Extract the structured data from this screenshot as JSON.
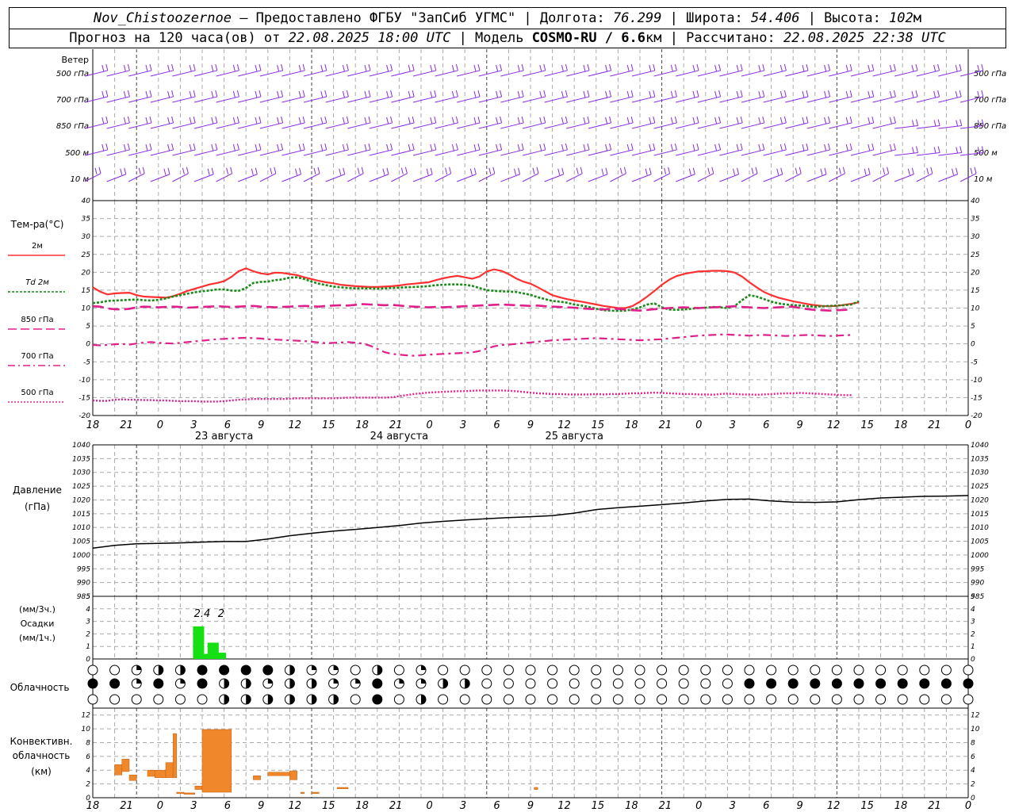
{
  "header": {
    "station": "Nov_Chistoozernoe",
    "provider": " – Предоставлено ФГБУ \"ЗапСиб УГМС\" | Долгота: ",
    "lon": "76.299",
    "lat_label": " | Широта: ",
    "lat": "54.406",
    "alt_label": " | Высота: ",
    "alt": "102",
    "alt_unit": "м",
    "forecast_label": "Прогноз на 120 часа(ов) от ",
    "forecast_from": "22.08.2025 18:00 UTC",
    "model_label": "  | Модель ",
    "model": "COSMO-RU / 6.6",
    "model_unit": "км",
    "computed_label": " | Рассчитано: ",
    "computed": "22.08.2025 22:38 UTC"
  },
  "labels": {
    "wind": "Ветер",
    "levels": [
      "500 гПа",
      "700 гПа",
      "850 гПа",
      "500 м",
      "10 м"
    ],
    "temp": "Тем-ра(°C)",
    "legend": [
      {
        "name": "2м",
        "color": "#ff3030",
        "dash": ""
      },
      {
        "name": "Td 2м",
        "color": "#178a17",
        "dash": "3,2"
      },
      {
        "name": "850 гПа",
        "color": "#e0208a",
        "dash": "11,5"
      },
      {
        "name": "700 гПа",
        "color": "#e0208a",
        "dash": "9,4,2,4"
      },
      {
        "name": "500 гПа",
        "color": "#e0208a",
        "dash": "2,2"
      }
    ],
    "pressure": "Давление",
    "pressure_unit": "(гПа)",
    "precip": [
      "(мм/3ч.)",
      "Осадки",
      "(мм/1ч.)"
    ],
    "precip_values": [
      "2.4",
      "2"
    ],
    "cloud": "Облачность",
    "conv": [
      "Конвективн.",
      "облачность",
      "(км)"
    ],
    "dates": [
      "23 августа",
      "24 августа",
      "25 августа"
    ],
    "hours": [
      "18",
      "21",
      "0",
      "3",
      "6",
      "9",
      "12",
      "15",
      "18",
      "21",
      "0",
      "3",
      "6",
      "9",
      "12",
      "15",
      "18",
      "21",
      "0",
      "3",
      "6",
      "9",
      "12",
      "15",
      "18",
      "21",
      "0"
    ]
  },
  "chart_data": [
    {
      "type": "line",
      "title": "Тем-ра(°C)",
      "ylim": [
        -20,
        40
      ],
      "x_hours_from_start": [
        0,
        1,
        2,
        3,
        4,
        5,
        6,
        7,
        8,
        9,
        10,
        11,
        12,
        13,
        14,
        15,
        16,
        17,
        18,
        19,
        20,
        21,
        22,
        23,
        24,
        25,
        26,
        27,
        28,
        29,
        30,
        31,
        32,
        33,
        34,
        35,
        36,
        37,
        38,
        39,
        40,
        41,
        42,
        43,
        44,
        45,
        46,
        47,
        48,
        49,
        50,
        51,
        52,
        53,
        54,
        55,
        56,
        57,
        58,
        59,
        60,
        61,
        62,
        63,
        64,
        65,
        66,
        67,
        68,
        69,
        70,
        71,
        72,
        73,
        74,
        75,
        76,
        77,
        78,
        79,
        80,
        81,
        82,
        83,
        84,
        85,
        86,
        87,
        88,
        89,
        90,
        91,
        92,
        93,
        94,
        95,
        96,
        97,
        98,
        99,
        100,
        101,
        102,
        103,
        104,
        105,
        106,
        107,
        108,
        109,
        110,
        111,
        112,
        113,
        114,
        115,
        116,
        117,
        118,
        119,
        120
      ],
      "series": [
        {
          "name": "2м",
          "values": [
            15.8,
            14.6,
            13.8,
            14.1,
            14.2,
            14.3,
            13.6,
            13.2,
            13.1,
            13.0,
            12.9,
            13.3,
            14.0,
            14.8,
            15.4,
            16.0,
            16.6,
            17.0,
            17.5,
            18.7,
            20.3,
            21.1,
            20.3,
            19.7,
            19.4,
            19.9,
            19.8,
            19.5,
            19.2,
            18.6,
            18.1,
            17.6,
            17.2,
            16.9,
            16.5,
            16.3,
            16.1,
            16.0,
            15.9,
            15.9,
            16.0,
            16.1,
            16.3,
            16.6,
            16.8,
            17.0,
            17.2,
            17.8,
            18.3,
            18.7,
            19.0,
            18.6,
            18.2,
            18.8,
            20.2,
            20.8,
            20.4,
            19.5,
            18.3,
            17.4,
            16.8,
            15.8,
            14.7,
            13.6,
            13.0,
            12.5,
            12.1,
            11.8,
            11.4,
            11.0,
            10.6,
            10.3,
            10.0,
            10.0,
            10.6,
            11.8,
            13.2,
            14.8,
            16.5,
            17.9,
            18.9,
            19.5,
            19.9,
            20.2,
            20.3,
            20.4,
            20.4,
            20.3,
            19.9,
            18.8,
            17.2,
            15.8,
            14.5,
            13.6,
            12.9,
            12.4,
            11.9,
            11.5,
            11.1,
            10.8,
            10.6,
            10.5,
            10.6,
            10.9,
            11.2,
            11.6
          ]
        },
        {
          "name": "Td 2м",
          "values": [
            11.4,
            11.6,
            12.0,
            12.1,
            12.2,
            12.3,
            12.4,
            12.2,
            12.1,
            12.3,
            12.7,
            13.2,
            13.6,
            14.0,
            14.4,
            14.7,
            14.9,
            15.2,
            15.2,
            14.9,
            14.8,
            15.6,
            17.0,
            17.3,
            17.4,
            17.8,
            18.0,
            18.5,
            18.6,
            18.1,
            17.4,
            16.8,
            16.4,
            16.0,
            15.8,
            15.6,
            15.5,
            15.5,
            15.5,
            15.4,
            15.5,
            15.6,
            15.7,
            15.8,
            15.9,
            16.0,
            16.1,
            16.4,
            16.5,
            16.6,
            16.6,
            16.5,
            16.2,
            15.6,
            15.0,
            14.8,
            14.7,
            14.6,
            14.5,
            14.1,
            13.7,
            13.0,
            12.5,
            12.0,
            11.8,
            11.5,
            11.0,
            10.7,
            10.3,
            9.8,
            9.4,
            9.3,
            9.2,
            9.3,
            9.6,
            10.2,
            11.0,
            11.3,
            10.2,
            9.6,
            9.5,
            9.6,
            9.8,
            10.0,
            10.1,
            10.3,
            10.2,
            10.0,
            10.6,
            12.2,
            13.6,
            13.2,
            12.5,
            11.8,
            11.3,
            11.0,
            10.8,
            10.7,
            10.5,
            10.4,
            10.5,
            10.6,
            10.7,
            10.8,
            11.0,
            11.9
          ]
        },
        {
          "name": "850 гПа",
          "values": [
            10.5,
            10.4,
            9.9,
            9.7,
            9.6,
            9.8,
            10.2,
            10.4,
            10.3,
            10.2,
            10.3,
            10.4,
            10.3,
            10.1,
            10.2,
            10.3,
            10.4,
            10.5,
            10.4,
            10.3,
            10.4,
            10.5,
            10.6,
            10.4,
            10.3,
            10.2,
            10.3,
            10.4,
            10.5,
            10.6,
            10.5,
            10.4,
            10.6,
            10.7,
            10.8,
            10.7,
            10.9,
            11.1,
            11.0,
            10.9,
            10.8,
            10.9,
            10.7,
            10.5,
            10.4,
            10.3,
            10.2,
            10.3,
            10.2,
            10.3,
            10.4,
            10.5,
            10.6,
            10.7,
            10.8,
            10.9,
            11.0,
            10.9,
            10.8,
            10.7,
            10.6,
            10.7,
            10.5,
            10.4,
            10.3,
            10.2,
            10.1,
            9.9,
            9.8,
            9.7,
            9.6,
            9.7,
            9.8,
            9.6,
            9.4,
            9.3,
            9.5,
            9.7,
            9.9,
            10.0,
            10.1,
            10.2,
            10.1,
            10.0,
            10.1,
            10.2,
            10.3,
            10.4,
            10.5,
            10.3,
            10.2,
            10.1,
            10.0,
            10.1,
            10.2,
            10.3,
            10.4,
            10.0,
            9.7,
            9.5,
            9.4,
            9.3,
            9.4,
            9.5,
            9.6
          ]
        },
        {
          "name": "700 гПа",
          "values": [
            -0.3,
            -0.4,
            -0.3,
            -0.1,
            0.0,
            -0.2,
            0.1,
            0.4,
            0.5,
            0.3,
            0.2,
            0.1,
            0.3,
            0.5,
            0.7,
            0.9,
            1.1,
            1.3,
            1.4,
            1.5,
            1.6,
            1.7,
            1.6,
            1.5,
            1.3,
            1.2,
            1.1,
            1.0,
            0.9,
            0.8,
            0.6,
            0.4,
            0.2,
            0.3,
            0.4,
            0.5,
            0.3,
            0.1,
            -0.5,
            -1.4,
            -2.3,
            -2.8,
            -3.0,
            -3.2,
            -3.3,
            -3.2,
            -3.0,
            -2.9,
            -2.8,
            -2.7,
            -2.6,
            -2.5,
            -2.4,
            -2.0,
            -1.3,
            -0.7,
            -0.3,
            -0.2,
            0.0,
            0.2,
            0.4,
            0.6,
            0.8,
            1.0,
            1.1,
            1.2,
            1.3,
            1.4,
            1.5,
            1.6,
            1.5,
            1.4,
            1.3,
            1.2,
            1.1,
            1.0,
            1.1,
            1.2,
            1.3,
            1.5,
            1.7,
            1.9,
            2.1,
            2.3,
            2.4,
            2.5,
            2.6,
            2.6,
            2.5,
            2.4,
            2.3,
            2.4,
            2.5,
            2.4,
            2.3,
            2.2,
            2.3,
            2.4,
            2.5,
            2.4,
            2.3,
            2.2,
            2.3,
            2.4,
            2.5
          ]
        },
        {
          "name": "500 гПа",
          "values": [
            -15.8,
            -15.9,
            -15.9,
            -15.6,
            -15.5,
            -15.6,
            -15.6,
            -15.7,
            -15.7,
            -15.8,
            -15.8,
            -15.9,
            -16.0,
            -16.0,
            -16.0,
            -16.1,
            -16.1,
            -16.1,
            -16.0,
            -15.8,
            -15.6,
            -15.5,
            -15.4,
            -15.4,
            -15.4,
            -15.4,
            -15.4,
            -15.3,
            -15.2,
            -15.2,
            -15.2,
            -15.2,
            -15.2,
            -15.2,
            -15.1,
            -15.0,
            -15.0,
            -15.0,
            -15.0,
            -15.0,
            -15.0,
            -14.9,
            -14.6,
            -14.3,
            -14.0,
            -13.8,
            -13.6,
            -13.5,
            -13.4,
            -13.3,
            -13.2,
            -13.2,
            -13.1,
            -13.0,
            -13.0,
            -13.0,
            -13.0,
            -13.1,
            -13.2,
            -13.4,
            -13.6,
            -13.8,
            -13.9,
            -14.0,
            -14.0,
            -14.1,
            -14.1,
            -14.1,
            -14.1,
            -14.0,
            -14.1,
            -14.0,
            -14.0,
            -13.9,
            -13.8,
            -13.8,
            -13.7,
            -13.6,
            -13.7,
            -13.8,
            -13.9,
            -14.0,
            -14.0,
            -14.1,
            -14.1,
            -14.2,
            -14.0,
            -13.9,
            -14.0,
            -14.1,
            -14.1,
            -14.2,
            -14.1,
            -14.0,
            -13.9,
            -13.8,
            -13.8,
            -13.7,
            -13.8,
            -13.9,
            -14.0,
            -14.1,
            -14.2,
            -14.3,
            -14.3
          ]
        }
      ]
    },
    {
      "type": "line",
      "title": "Давление",
      "ylabel": "(гПа)",
      "ylim": [
        985,
        1040
      ],
      "x_hours_from_start": [
        0,
        3,
        6,
        9,
        12,
        15,
        18,
        21,
        24,
        27,
        30,
        33,
        36,
        39,
        42,
        45,
        48,
        51,
        54,
        57,
        60,
        63,
        66,
        69,
        72,
        75,
        78,
        81,
        84,
        87,
        90,
        93,
        96,
        99,
        102,
        105,
        108,
        111,
        114,
        117,
        120
      ],
      "series": [
        {
          "name": "Давление",
          "values": [
            1002.5,
            1003.5,
            1004.1,
            1004.2,
            1004.4,
            1004.7,
            1004.9,
            1004.9,
            1005.8,
            1007.0,
            1007.9,
            1008.7,
            1009.3,
            1010.0,
            1010.7,
            1011.6,
            1012.2,
            1012.7,
            1013.2,
            1013.6,
            1013.9,
            1014.3,
            1015.2,
            1016.5,
            1017.2,
            1017.7,
            1018.3,
            1018.9,
            1019.6,
            1020.2,
            1020.3,
            1019.6,
            1019.2,
            1019.1,
            1019.3,
            1020.1,
            1020.7,
            1021.0,
            1021.3,
            1021.4,
            1021.6
          ]
        }
      ]
    },
    {
      "type": "bar",
      "title": "Осадки",
      "ylim": [
        0,
        5
      ],
      "series": [
        {
          "name": "Осадки",
          "x_hours_from_start": [
            14.5,
            15.5,
            16.5,
            17.5
          ],
          "values": [
            2.6,
            0.4,
            1.3,
            0.5
          ]
        }
      ]
    },
    {
      "type": "bar",
      "title": "Конвективн. облачность",
      "ylabel": "(км)",
      "ylim": [
        0,
        13
      ],
      "series": [
        {
          "name": "Конвективн. облачность",
          "segments": [
            {
              "x0": 3,
              "x1": 4,
              "lo": 3.3,
              "hi": 4.8
            },
            {
              "x0": 4,
              "x1": 5,
              "lo": 3.8,
              "hi": 5.6
            },
            {
              "x0": 5,
              "x1": 6,
              "lo": 2.5,
              "hi": 3.3
            },
            {
              "x0": 7.5,
              "x1": 8.5,
              "lo": 3.1,
              "hi": 4.0
            },
            {
              "x0": 8.5,
              "x1": 10,
              "lo": 2.9,
              "hi": 4.0
            },
            {
              "x0": 10,
              "x1": 11,
              "lo": 2.9,
              "hi": 5.1
            },
            {
              "x0": 11,
              "x1": 11.5,
              "lo": 2.9,
              "hi": 9.3
            },
            {
              "x0": 11.5,
              "x1": 12.5,
              "lo": 0.6,
              "hi": 0.8
            },
            {
              "x0": 12.5,
              "x1": 14,
              "lo": 0.5,
              "hi": 0.7
            },
            {
              "x0": 14,
              "x1": 15,
              "lo": 1.2,
              "hi": 1.7
            },
            {
              "x0": 15,
              "x1": 19,
              "lo": 0.8,
              "hi": 9.9
            },
            {
              "x0": 22,
              "x1": 23,
              "lo": 2.6,
              "hi": 3.2
            },
            {
              "x0": 24,
              "x1": 27,
              "lo": 3.2,
              "hi": 3.7
            },
            {
              "x0": 27,
              "x1": 28,
              "lo": 2.6,
              "hi": 3.9
            },
            {
              "x0": 28.5,
              "x1": 29,
              "lo": 0.6,
              "hi": 0.8
            },
            {
              "x0": 30,
              "x1": 31,
              "lo": 0.6,
              "hi": 0.8
            },
            {
              "x0": 33.5,
              "x1": 35,
              "lo": 1.3,
              "hi": 1.5
            },
            {
              "x0": 60.5,
              "x1": 61,
              "lo": 1.2,
              "hi": 1.5
            }
          ]
        }
      ]
    }
  ],
  "cloud_rows": {
    "row1": "0012233332110201000000000000000000000000000000000000000000000000000000000000000000000000000000000000000000000000000000000000000",
    "row2": "3313132212211311220000000000003333333333333330000000000000000000000000000000000000000000000000000000000000000000000000000000000",
    "row3": "0000002222220302000000000000000000000000000000000000000000000000000000000000000000000000000000000000000000000000000000000000000"
  },
  "cloud_cover": {
    "row1": [
      0,
      0,
      1,
      2,
      2,
      3,
      3,
      3,
      3,
      2,
      1,
      1,
      0,
      2,
      0,
      1,
      0,
      0,
      0,
      0,
      0,
      0,
      0,
      0,
      0,
      0,
      0,
      0,
      0,
      0,
      0,
      0,
      0,
      0,
      0,
      0,
      0,
      0,
      0,
      0,
      0
    ],
    "row2": [
      3,
      3,
      1,
      3,
      1,
      3,
      2,
      2,
      1,
      2,
      2,
      1,
      1,
      3,
      1,
      1,
      2,
      2,
      0,
      0,
      0,
      0,
      0,
      0,
      0,
      0,
      0,
      0,
      0,
      0,
      3,
      3,
      3,
      3,
      3,
      3,
      3,
      3,
      3,
      3,
      3
    ],
    "row3": [
      0,
      0,
      0,
      0,
      0,
      0,
      2,
      2,
      2,
      2,
      2,
      2,
      0,
      3,
      0,
      2,
      0,
      0,
      0,
      0,
      0,
      0,
      0,
      0,
      0,
      0,
      0,
      0,
      0,
      0,
      0,
      0,
      0,
      0,
      0,
      0,
      0,
      0,
      0,
      0,
      0
    ]
  },
  "wind_note": "",
  "colors": {
    "wind": "#8a2be2",
    "temp": "#ff3030",
    "dew": "#178a17",
    "upper": "#e0208a",
    "precip": "#14e014",
    "conv": "#f0872a"
  }
}
